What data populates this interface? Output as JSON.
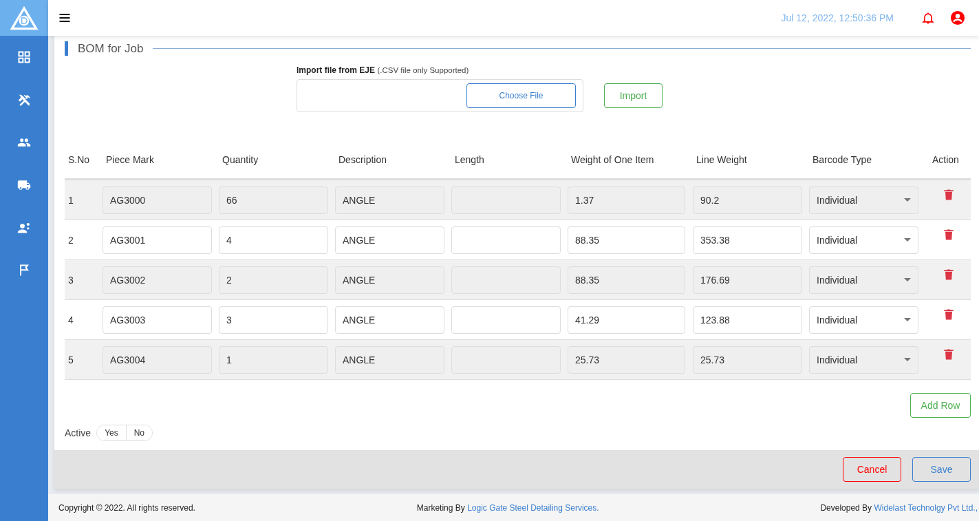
{
  "header": {
    "datetime": "Jul 12, 2022, 12:50:36 PM"
  },
  "page": {
    "title": "BOM for Job"
  },
  "import": {
    "label": "Import file from EJE",
    "hint": "(.CSV file only Supported)",
    "choose_button": "Choose File",
    "import_button": "Import"
  },
  "table": {
    "columns": [
      "S.No",
      "Piece Mark",
      "Quantity",
      "Description",
      "Length",
      "Weight of One Item",
      "Line Weight",
      "Barcode Type",
      "Action"
    ],
    "rows": [
      {
        "sno": "1",
        "piece_mark": "AG3000",
        "quantity": "66",
        "description": "ANGLE",
        "weight_one": "1.37",
        "line_weight": "90.2",
        "barcode_type": "Individual"
      },
      {
        "sno": "2",
        "piece_mark": "AG3001",
        "quantity": "4",
        "description": "ANGLE",
        "weight_one": "88.35",
        "line_weight": "353.38",
        "barcode_type": "Individual"
      },
      {
        "sno": "3",
        "piece_mark": "AG3002",
        "quantity": "2",
        "description": "ANGLE",
        "weight_one": "88.35",
        "line_weight": "176.69",
        "barcode_type": "Individual"
      },
      {
        "sno": "4",
        "piece_mark": "AG3003",
        "quantity": "3",
        "description": "ANGLE",
        "weight_one": "41.29",
        "line_weight": "123.88",
        "barcode_type": "Individual"
      },
      {
        "sno": "5",
        "piece_mark": "AG3004",
        "quantity": "1",
        "description": "ANGLE",
        "weight_one": "25.73",
        "line_weight": "25.73",
        "barcode_type": "Individual"
      }
    ]
  },
  "add_row_button": "Add Row",
  "active": {
    "label": "Active",
    "options": [
      {
        "label": "Yes",
        "selected": false
      },
      {
        "label": "No",
        "selected": false
      }
    ]
  },
  "actions": {
    "cancel": "Cancel",
    "save": "Save"
  },
  "footer": {
    "copyright": "Copyright © 2022. All rights reserved.",
    "marketing_prefix": "Marketing By",
    "marketing_link": "Logic Gate Steel Detailing Services.",
    "developer_prefix": "Developed By",
    "developer_link": "Widelast Technolgy Pvt Ltd.,"
  }
}
